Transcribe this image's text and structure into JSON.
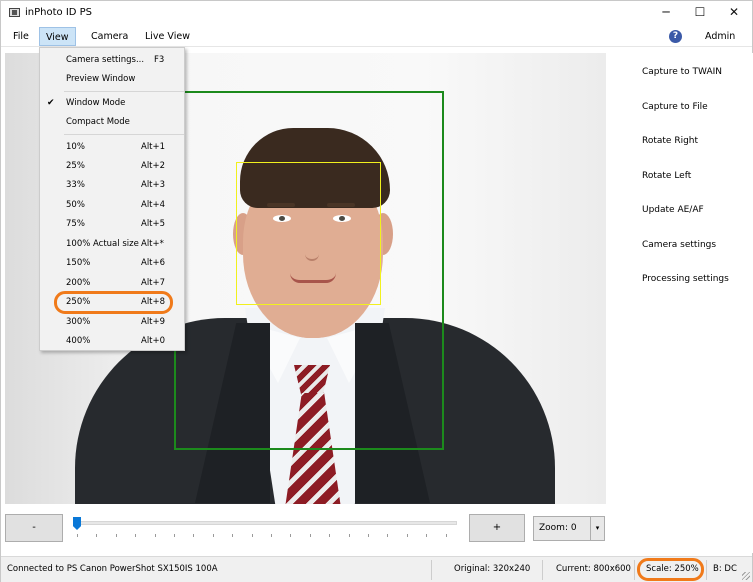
{
  "window": {
    "title": "inPhoto ID PS",
    "minimize": "─",
    "maximize": "☐",
    "close": "✕"
  },
  "menubar": {
    "file": "File",
    "view": "View",
    "camera": "Camera",
    "live_view": "Live View",
    "help": "?",
    "admin": "Admin"
  },
  "view_menu": {
    "items": [
      {
        "label": "Camera settings...",
        "shortcut": "F3"
      },
      {
        "label": "Preview Window",
        "shortcut": ""
      },
      {
        "label": "Window Mode",
        "shortcut": "",
        "checked": true
      },
      {
        "label": "Compact Mode",
        "shortcut": ""
      },
      {
        "label": "10%",
        "shortcut": "Alt+1"
      },
      {
        "label": "25%",
        "shortcut": "Alt+2"
      },
      {
        "label": "33%",
        "shortcut": "Alt+3"
      },
      {
        "label": "50%",
        "shortcut": "Alt+4"
      },
      {
        "label": "75%",
        "shortcut": "Alt+5"
      },
      {
        "label": "100% Actual size",
        "shortcut": "Alt+*"
      },
      {
        "label": "150%",
        "shortcut": "Alt+6"
      },
      {
        "label": "200%",
        "shortcut": "Alt+7"
      },
      {
        "label": "250%",
        "shortcut": "Alt+8"
      },
      {
        "label": "300%",
        "shortcut": "Alt+9"
      },
      {
        "label": "400%",
        "shortcut": "Alt+0"
      }
    ],
    "check_mark": "✔"
  },
  "right_panel": {
    "buttons": [
      "Capture to TWAIN",
      "Capture to File",
      "Rotate Right",
      "Rotate Left",
      "Update AE/AF",
      "Camera settings",
      "Processing settings"
    ]
  },
  "toolbar": {
    "minus": "-",
    "plus": "+",
    "zoom": "Zoom: 0",
    "zoom_arrow": "▾",
    "slider_value": 0
  },
  "statusbar": {
    "connection": "Connected to PS Canon PowerShot SX150IS 100A",
    "original": "Original: 320x240",
    "current": "Current: 800x600",
    "scale": "Scale: 250%",
    "b": "B: DC"
  },
  "colors": {
    "face_frame": "#1c8a1c",
    "eye_frame": "#f1f11d",
    "highlight": "#f07a1a",
    "slider": "#0a78d7"
  }
}
